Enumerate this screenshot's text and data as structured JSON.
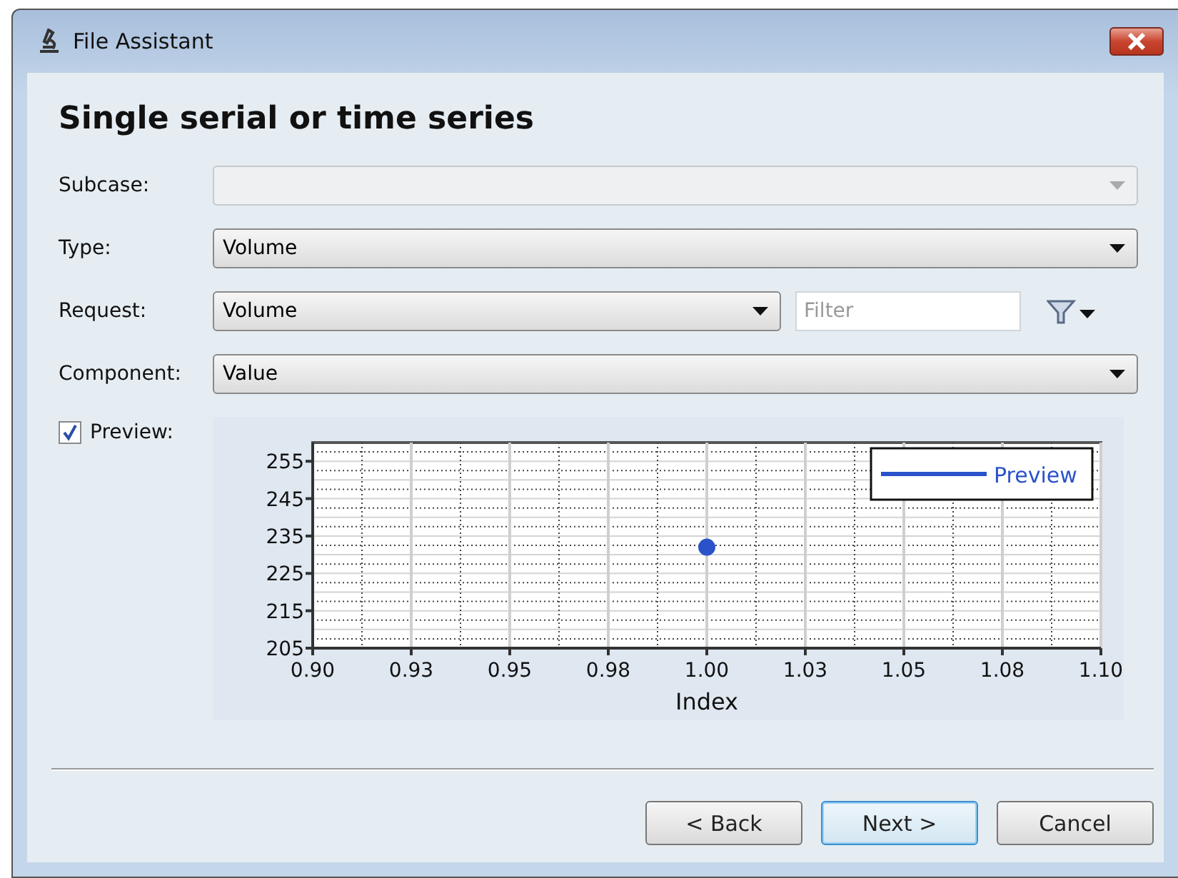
{
  "window": {
    "title": "File Assistant"
  },
  "heading": "Single serial or time series",
  "fields": [
    {
      "label": "Subcase:",
      "kind": "dropdown",
      "disabled": true
    },
    {
      "label": "Type:",
      "kind": "dropdown",
      "value": "Volume",
      "disabled": false
    },
    {
      "label": "Request:",
      "kind": "dropdown_filter",
      "value": "Volume",
      "placeholder": "Filter",
      "disabled": false
    },
    {
      "label": "Component:",
      "kind": "dropdown",
      "value": "Value",
      "disabled": false
    }
  ],
  "preview": {
    "label": "Preview:",
    "checked": true,
    "chart_data": {
      "type": "scatter",
      "xlabel": "Index",
      "x": [
        1.0
      ],
      "series": [
        {
          "name": "Preview",
          "color": "#2a52c9",
          "values": [
            232
          ]
        }
      ],
      "xlim": [
        0.9,
        1.1
      ],
      "ylim": [
        205,
        260
      ],
      "xticks": [
        {
          "value": 0.9,
          "label": "0.90"
        },
        {
          "value": 0.925,
          "label": "0.93"
        },
        {
          "value": 0.95,
          "label": "0.95"
        },
        {
          "value": 0.975,
          "label": "0.98"
        },
        {
          "value": 1.0,
          "label": "1.00"
        },
        {
          "value": 1.025,
          "label": "1.03"
        },
        {
          "value": 1.05,
          "label": "1.05"
        },
        {
          "value": 1.075,
          "label": "1.08"
        },
        {
          "value": 1.1,
          "label": "1.10"
        }
      ],
      "yticks": [
        205,
        215,
        225,
        235,
        245,
        255
      ],
      "grid": true
    }
  },
  "buttons": [
    {
      "label": "< Back",
      "default": false
    },
    {
      "label": "Next >",
      "default": true
    },
    {
      "label": "Cancel",
      "default": false
    }
  ]
}
